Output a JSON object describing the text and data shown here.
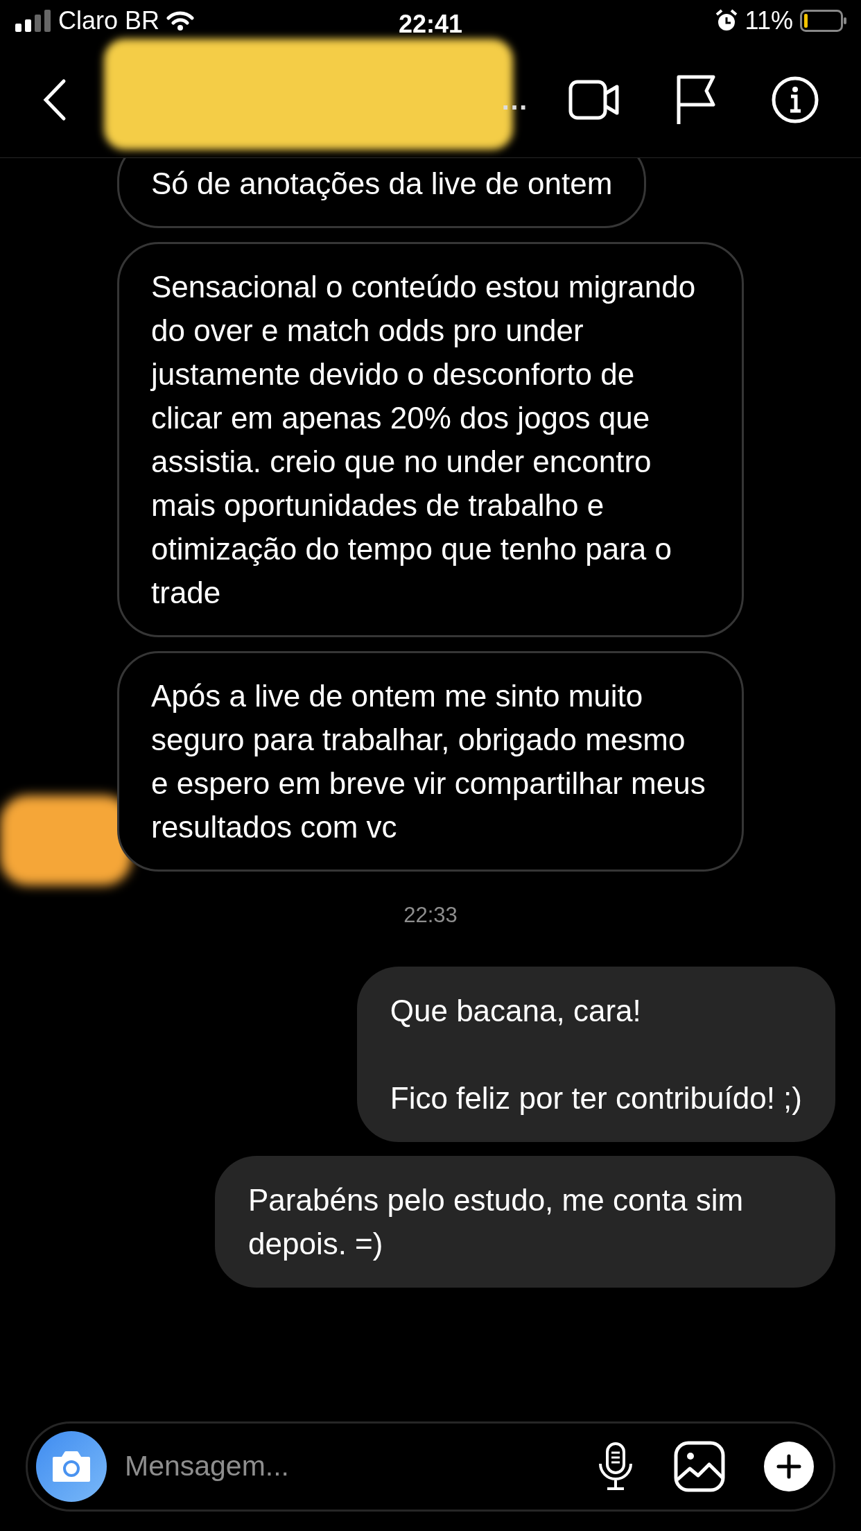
{
  "status_bar": {
    "carrier": "Claro BR",
    "time": "22:41",
    "battery": "11%"
  },
  "header": {
    "title": "…"
  },
  "messages": [
    {
      "kind": "received",
      "text": "Só de anotações da live de ontem",
      "cut_top": true,
      "avatar": false
    },
    {
      "kind": "received",
      "text": "Sensacional o conteúdo estou migrando do over e match odds pro under justamente devido o desconforto de clicar em apenas 20% dos jogos que assistia. creio que no under encontro mais oportunidades de trabalho e otimização do tempo que tenho para o trade",
      "cut_top": false,
      "avatar": false
    },
    {
      "kind": "received",
      "text": "Após a live de ontem me sinto muito seguro para trabalhar, obrigado mesmo e espero em breve vir compartilhar meus resultados com vc",
      "cut_top": false,
      "avatar": true
    },
    {
      "kind": "time",
      "text": "22:33"
    },
    {
      "kind": "sent",
      "text": "Que bacana, cara!\n\nFico feliz por ter contribuído! ;)"
    },
    {
      "kind": "sent",
      "text": "Parabéns pelo estudo, me conta sim depois. =)"
    }
  ],
  "composer": {
    "placeholder": "Mensagem..."
  }
}
